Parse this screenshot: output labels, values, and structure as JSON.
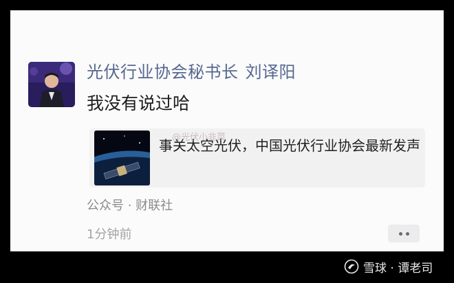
{
  "post": {
    "author": "光伏行业协会秘书长",
    "author_name": "刘译阳",
    "message": "我没有说过哈"
  },
  "link_card": {
    "title": "事关太空光伏，中国光伏行业协会最新发声",
    "watermark": "@光伏小韭菜"
  },
  "meta": {
    "source": "公众号 · 财联社",
    "time": "1分钟前"
  },
  "icons": {
    "more": "more-dots-icon",
    "avatar": "avatar-photo",
    "thumbnail": "satellite-thumbnail"
  },
  "watermark": {
    "text": "雪球 · 谭老司"
  },
  "colors": {
    "author": "#56678f",
    "card_bg": "#f1f1f1",
    "meta": "#8b8b8b"
  }
}
